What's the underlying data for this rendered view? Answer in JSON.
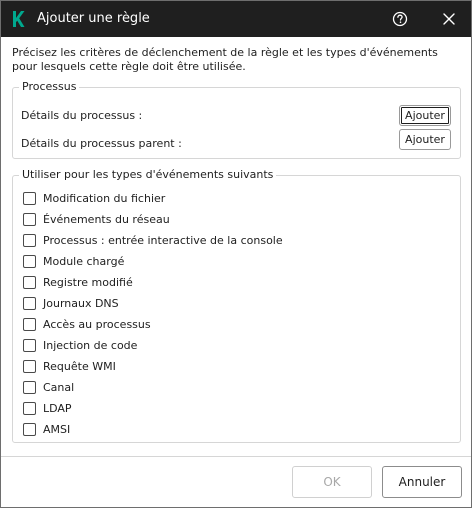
{
  "window": {
    "title": "Ajouter une règle",
    "icons": {
      "logo": "kaspersky-k-logo",
      "help": "help-icon",
      "close": "close-icon"
    },
    "colors": {
      "titlebar": "#1f1f1f",
      "logo": "#00a88e"
    }
  },
  "description": "Précisez les critères de déclenchement de la règle et les types d'événements pour lesquels cette règle doit être utilisée.",
  "process_group": {
    "title": "Processus",
    "rows": [
      {
        "label": "Détails du processus :",
        "button": "Ajouter"
      },
      {
        "label": "Détails du processus parent :",
        "button": "Ajouter"
      }
    ]
  },
  "event_types": {
    "title": "Utiliser pour les types d'événements suivants",
    "items": [
      {
        "label": "Modification du fichier",
        "checked": false
      },
      {
        "label": "Événements du réseau",
        "checked": false
      },
      {
        "label": "Processus : entrée interactive de la console",
        "checked": false
      },
      {
        "label": "Module chargé",
        "checked": false
      },
      {
        "label": "Registre modifié",
        "checked": false
      },
      {
        "label": "Journaux DNS",
        "checked": false
      },
      {
        "label": "Accès au processus",
        "checked": false
      },
      {
        "label": "Injection de code",
        "checked": false
      },
      {
        "label": "Requête WMI",
        "checked": false
      },
      {
        "label": "Canal",
        "checked": false
      },
      {
        "label": "LDAP",
        "checked": false
      },
      {
        "label": "AMSI",
        "checked": false
      }
    ]
  },
  "footer": {
    "ok_label": "OK",
    "ok_enabled": false,
    "cancel_label": "Annuler"
  }
}
